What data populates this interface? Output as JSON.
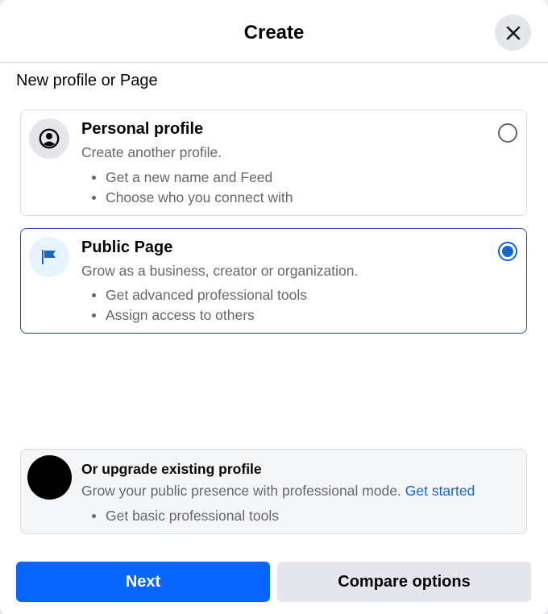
{
  "dialog": {
    "title": "Create",
    "close_icon": "close-icon"
  },
  "section": {
    "title": "New profile or Page"
  },
  "options": [
    {
      "icon": "user-circle-icon",
      "title": "Personal profile",
      "description": "Create another profile.",
      "bullets": [
        "Get a new name and Feed",
        "Choose who you connect with"
      ],
      "selected": false
    },
    {
      "icon": "flag-icon",
      "title": "Public Page",
      "description": "Grow as a business, creator or organization.",
      "bullets": [
        "Get advanced professional tools",
        "Assign access to others"
      ],
      "selected": true
    }
  ],
  "upgrade": {
    "title": "Or upgrade existing profile",
    "description": "Grow your public presence with professional mode.",
    "link": "Get started",
    "bullets": [
      "Get basic professional tools"
    ]
  },
  "buttons": {
    "next": "Next",
    "compare": "Compare options"
  },
  "colors": {
    "primary": "#0866ff",
    "link": "#1467cf",
    "secondary_bg": "#e4e6eb",
    "selected_border": "#1b4fb5"
  }
}
